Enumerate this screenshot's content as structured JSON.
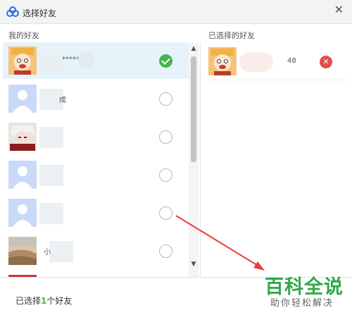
{
  "window": {
    "title": "选择好友",
    "close_symbol": "✕"
  },
  "left_panel": {
    "header": "我的好友",
    "friends": [
      {
        "name": "*****",
        "selected": true,
        "avatar": "cartoon-character"
      },
      {
        "name": "成",
        "selected": false,
        "avatar": "default-person"
      },
      {
        "name": "",
        "selected": false,
        "avatar": "anime-character"
      },
      {
        "name": "",
        "selected": false,
        "avatar": "default-person"
      },
      {
        "name": "",
        "selected": false,
        "avatar": "default-person"
      },
      {
        "name": "小",
        "selected": false,
        "avatar": "landscape-photo"
      },
      {
        "name": "",
        "selected": false,
        "avatar": "red-photo"
      }
    ]
  },
  "right_panel": {
    "header": "已选择的好友",
    "selected": [
      {
        "name": "48",
        "avatar": "cartoon-character"
      }
    ]
  },
  "footer": {
    "prefix": "已选择",
    "count": "1",
    "suffix": "个好友"
  },
  "watermark": {
    "title": "百科全说",
    "subtitle": "助你轻松解决"
  },
  "colors": {
    "accent_green": "#44b549",
    "remove_red": "#e54b4b",
    "selected_row": "#e6f3fb"
  }
}
